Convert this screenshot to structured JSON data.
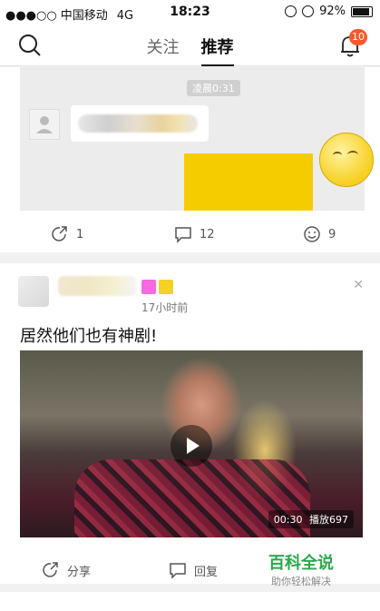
{
  "status_bar": {
    "signal": "●●●○○",
    "carrier": "中国移动",
    "network": "4G",
    "time": "18:23",
    "battery": "92%"
  },
  "nav": {
    "tabs": [
      {
        "label": "关注",
        "active": false
      },
      {
        "label": "推荐",
        "active": true
      }
    ],
    "notification_count": "10"
  },
  "card1": {
    "chat_time": "凌晨0:31",
    "actions": [
      {
        "icon": "share-icon",
        "count": "1"
      },
      {
        "icon": "comment-icon",
        "count": "12"
      },
      {
        "icon": "like-icon",
        "count": "9"
      }
    ]
  },
  "card2": {
    "post_time": "17小时前",
    "title": "居然他们也有神剧!",
    "video": {
      "duration": "00:30",
      "plays": "播放697"
    },
    "actions": [
      {
        "icon": "share-icon",
        "label": "分享"
      },
      {
        "icon": "comment-icon",
        "label": "回复"
      }
    ]
  },
  "watermark": {
    "title": "百科全说",
    "subtitle": "助你轻松解决"
  },
  "colors": {
    "badge": "#f85a2b",
    "watermark": "#2aa84a"
  }
}
